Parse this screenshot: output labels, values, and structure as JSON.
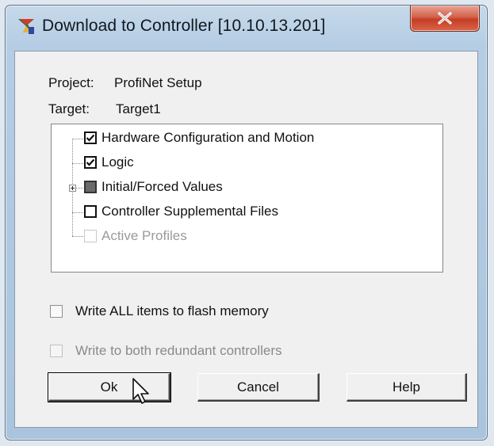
{
  "window": {
    "title": "Download to Controller [10.10.13.201]",
    "close_label": "×"
  },
  "project": {
    "label": "Project:",
    "value": "ProfiNet Setup"
  },
  "target": {
    "label": "Target:",
    "value": "Target1"
  },
  "tree": {
    "items": [
      {
        "label": "Hardware Configuration and Motion",
        "state": "checked",
        "enabled": true
      },
      {
        "label": "Logic",
        "state": "checked",
        "enabled": true
      },
      {
        "label": "Initial/Forced Values",
        "state": "indeterminate",
        "enabled": true,
        "expandable": true
      },
      {
        "label": "Controller Supplemental Files",
        "state": "unchecked",
        "enabled": true
      },
      {
        "label": "Active Profiles",
        "state": "unchecked",
        "enabled": false
      }
    ]
  },
  "options": {
    "flash": {
      "label": "Write ALL items to flash memory",
      "checked": false,
      "enabled": true
    },
    "redundant": {
      "label": "Write to both redundant controllers",
      "checked": false,
      "enabled": false
    }
  },
  "buttons": {
    "ok": "Ok",
    "cancel": "Cancel",
    "help": "Help"
  },
  "colors": {
    "checkbox_fill_indeterminate": "#6a6a6a",
    "close_button": "#c43e24"
  }
}
